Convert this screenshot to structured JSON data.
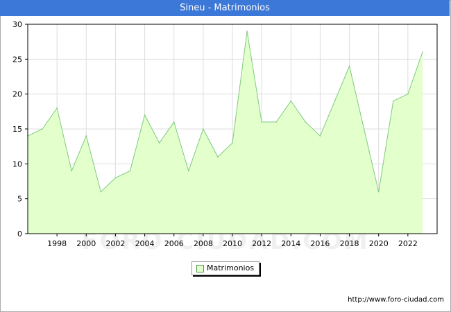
{
  "header": {
    "title": "Sineu - Matrimonios"
  },
  "watermark": "FORO-CIUDAD.COM",
  "source": "http://www.foro-ciudad.com",
  "chart_data": {
    "type": "area",
    "title": "Sineu - Matrimonios",
    "xlabel": "",
    "ylabel": "",
    "xlim": [
      1996,
      2024
    ],
    "ylim": [
      0,
      30
    ],
    "grid": true,
    "legend_position": "bottom-center",
    "x_ticks": [
      1998,
      2000,
      2002,
      2004,
      2006,
      2008,
      2010,
      2012,
      2014,
      2016,
      2018,
      2020,
      2022
    ],
    "y_ticks": [
      0,
      5,
      10,
      15,
      20,
      25,
      30
    ],
    "series": [
      {
        "name": "Matrimonios",
        "fill_color": "#e2ffcc",
        "line_color": "#7fc97f",
        "x": [
          1996,
          1997,
          1998,
          1999,
          2000,
          2001,
          2002,
          2003,
          2004,
          2005,
          2006,
          2007,
          2008,
          2009,
          2010,
          2011,
          2012,
          2013,
          2014,
          2015,
          2016,
          2017,
          2018,
          2019,
          2020,
          2021,
          2022,
          2023
        ],
        "y": [
          14,
          15,
          18,
          9,
          14,
          6,
          8,
          9,
          17,
          13,
          16,
          9,
          15,
          11,
          13,
          29,
          16,
          16,
          19,
          16,
          14,
          19,
          24,
          15,
          6,
          19,
          20,
          26
        ]
      }
    ]
  }
}
